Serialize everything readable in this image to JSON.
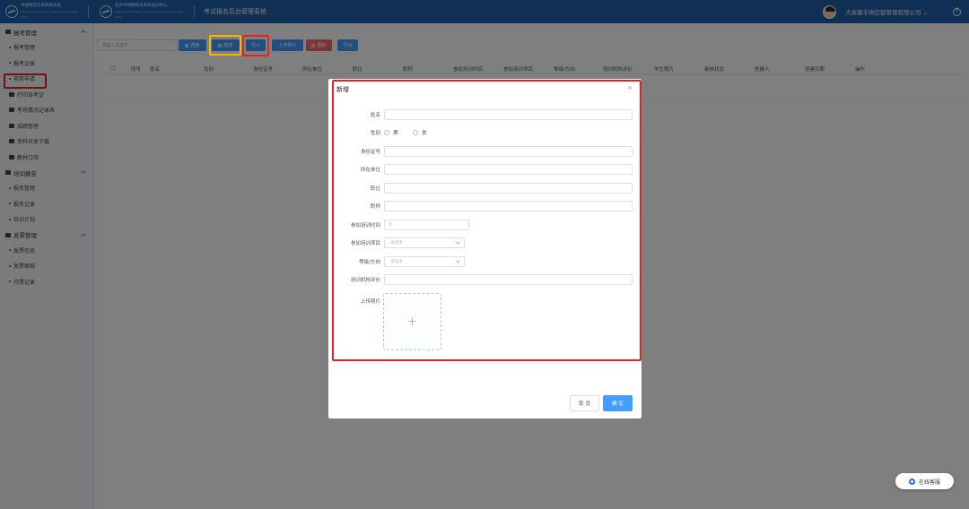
{
  "header": {
    "logo1_line1": "中国物流与采购联合会",
    "logo1_line2": "China Federation of Logistics & Purchasing",
    "logo1_mark": "CFLP",
    "logo2_line1": "北京中物联物流采购培训中心",
    "logo2_line2": "Beijing CFLP Logistics & Purchasing Training Center",
    "logo2_mark": "CFLP",
    "system_title": "考试报名后台管理系统",
    "company_name": "大连蓉丰供应链管理有限公司",
    "company_dropdown": "⌄"
  },
  "sidebar": {
    "groups": [
      {
        "label": "报考管理"
      },
      {
        "label": "培训报名"
      },
      {
        "label": "发票管理"
      }
    ],
    "items_g1": [
      "报考管理",
      "报考记录",
      "项目申请"
    ],
    "items_g1_icons": [
      "打印准考证",
      "考场情况记录表",
      "成绩管理",
      "资料共享下载",
      "教材订阅"
    ],
    "items_g2": [
      "报名管理",
      "报名记录",
      "培训计划"
    ],
    "items_g3": [
      "发票信息",
      "发票索取",
      "开票记录"
    ]
  },
  "toolbar": {
    "search_placeholder": "请输入关键字",
    "search_btn": "搜索",
    "add_btn": "新增",
    "import_btn": "导入",
    "upload_photo_btn": "上传照片",
    "delete_btn": "删除",
    "export_btn": "导出"
  },
  "table": {
    "headers": [
      "序号",
      "姓名",
      "性别",
      "身份证号",
      "所在单位",
      "职位",
      "职称",
      "参加培训时间",
      "参加培训项目",
      "等级/方向",
      "培训机构评价",
      "学生照片",
      "审核状态",
      "创建人",
      "创建日期",
      "操作"
    ]
  },
  "modal": {
    "title": "新增",
    "close": "×",
    "labels": {
      "name": "姓名",
      "gender": "性别",
      "id_number": "身份证号",
      "company": "所在单位",
      "position": "职位",
      "title": "职称",
      "train_time": "参加培训时间",
      "train_project": "参加培训项目",
      "level": "等级/方向",
      "org_eval": "培训机构评价",
      "photo": "上传照片"
    },
    "gender_options": [
      "男",
      "女"
    ],
    "year_placeholder": "年",
    "select_placeholder": "请选择",
    "upload_plus": "+",
    "cancel": "取 消",
    "confirm": "确 定"
  },
  "chat": {
    "label": "在线客服"
  },
  "colors": {
    "header_bg": "#1f5ea8",
    "primary": "#409eff",
    "danger": "#f56c6c",
    "highlight_red": "#e52323",
    "highlight_yellow": "#f6b500"
  }
}
